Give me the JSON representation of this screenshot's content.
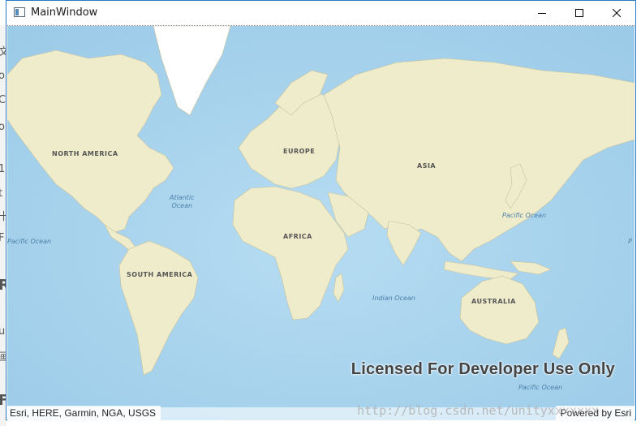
{
  "window": {
    "title": "MainWindow",
    "controls": [
      "minimize",
      "maximize",
      "close"
    ]
  },
  "map": {
    "basemap": "topographic",
    "labels": {
      "north_america": "NORTH AMERICA",
      "europe": "EUROPE",
      "asia": "ASIA",
      "africa": "AFRICA",
      "south_america": "SOUTH AMERICA",
      "australia": "AUSTRALIA",
      "atlantic_ocean_line1": "Atlantic",
      "atlantic_ocean_line2": "Ocean",
      "pacific_ocean_left": "Pacific Ocean",
      "pacific_ocean_right": "Pacific Ocean",
      "pacific_ocean_bottom": "Pacific Ocean",
      "indian_ocean": "Indian Ocean",
      "pacific_edge_right": "P"
    },
    "license_text": "Licensed For Developer Use Only",
    "attribution": "Esri, HERE, Garmin, NGA, USGS",
    "powered_by": "Powered by Esri"
  },
  "watermark": "http://blog.csdn.net/unityxxxxxxx",
  "colors": {
    "ocean": "#a9d4ee",
    "land": "#efeccb",
    "greenland": "#ffffff",
    "window_border": "#2b79c2"
  }
}
